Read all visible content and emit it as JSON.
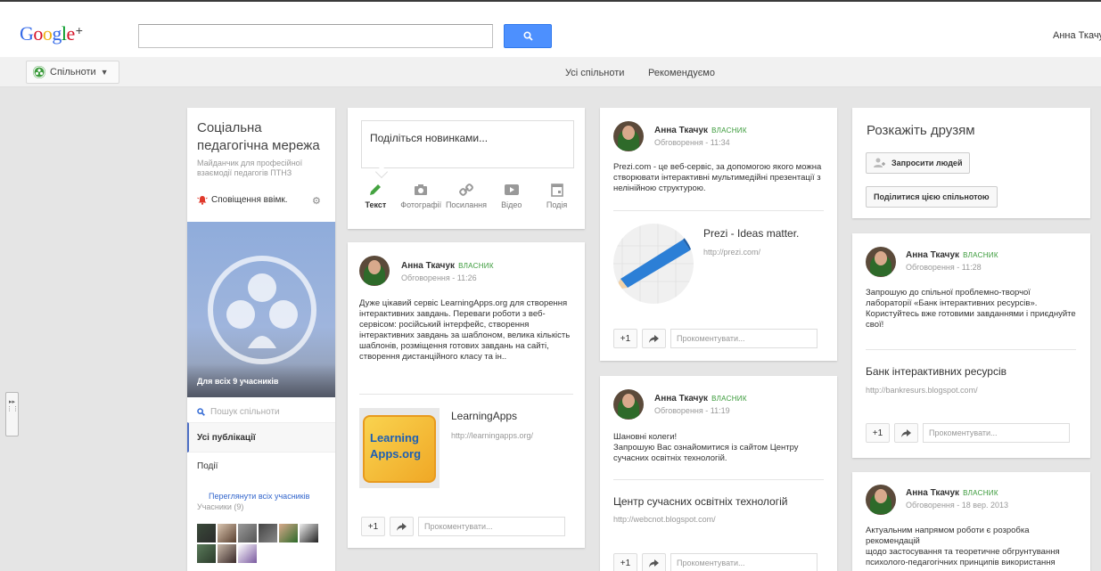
{
  "header": {
    "logo_text": "Google",
    "logo_plus": "+",
    "search_placeholder": "",
    "search_button_icon": "search-icon",
    "user_name": "Анна Ткачук"
  },
  "subnav": {
    "communities_label": "Спільноти",
    "tabs": [
      "Усі спільноти",
      "Рекомендуємо"
    ]
  },
  "community": {
    "title": "Соціальна педагогічна мережа",
    "description": "Майданчик для професійної взаємодії педагогів ПТНЗ",
    "notifications": "Сповіщення ввімк.",
    "members_line": "Для всіх   9 учасників",
    "search_placeholder": "Пошук спільноти",
    "nav_all": "Усі публікації",
    "nav_events": "Події",
    "view_members": "Переглянути всіх учасників",
    "members_count": "Учасники (9)"
  },
  "share_box": {
    "placeholder": "Поділіться новинками...",
    "tools": [
      {
        "label": "Текст",
        "icon": "pencil-icon"
      },
      {
        "label": "Фотографії",
        "icon": "camera-icon"
      },
      {
        "label": "Посилання",
        "icon": "link-icon"
      },
      {
        "label": "Відео",
        "icon": "video-icon"
      },
      {
        "label": "Подія",
        "icon": "calendar-icon"
      }
    ]
  },
  "common": {
    "owner_badge": "ВЛАСНИК",
    "plus_one": "+1",
    "comment_placeholder": "Прокоментувати..."
  },
  "posts": {
    "learningapps": {
      "author": "Анна Ткачук",
      "meta": "Обговорення  -  11:26",
      "text": "Дуже цікавий сервіс LearningApps.org  для створення інтерактивних завдань.  Переваги роботи з веб-сервісом: російський інтерфейс, створення інтерактивних завдань за шаблоном, велика кількість шаблонів, розміщення готових завдань на сайті, створення дистанційного класу та ін..",
      "link_title": "LearningApps",
      "link_url": "http://learningapps.org/",
      "thumb_line1": "Learning",
      "thumb_line2": "Apps.org"
    },
    "prezi": {
      "author": "Анна Ткачук",
      "meta": "Обговорення  -  11:34",
      "text": "Prezi.com - це веб-сервіс, за допомогою якого можна створювати інтерактивні мультимедійні презентації з нелінійною структурою.",
      "link_title": "Prezi - Ideas matter.",
      "link_url": "http://prezi.com/"
    },
    "webcnot": {
      "author": "Анна Ткачук",
      "meta": "Обговорення  -  11:19",
      "text": "Шановні колеги!\nЗапрошую Вас ознайомитися із сайтом Центру сучасних освітніх технологій.",
      "link_title": "Центр сучасних освітніх технологій",
      "link_url": "http://webcnot.blogspot.com/"
    },
    "bankresurs": {
      "author": "Анна Ткачук",
      "meta": "Обговорення  -  11:28",
      "text": "Запрошую до спільної проблемно-творчої лабораторії «Банк інтерактивних ресурсів». Користуйтесь вже готовими завданнями і приєднуйте свої!",
      "link_title": "Банк інтерактивних ресурсів",
      "link_url": "http://bankresurs.blogspot.com/"
    },
    "sep": {
      "author": "Анна Ткачук",
      "meta": "Обговорення  -  18 вер. 2013",
      "text": "Актуальним напрямом роботи є розробка рекомендацій\nщодо застосування та теоретичне обгрунтування психолого-педагогічних принципів використання"
    }
  },
  "tell_friends": {
    "title": "Розкажіть друзям",
    "invite_label": "Запросити людей",
    "share_label": "Поділитися цією спільнотою"
  },
  "colors": {
    "accent_blue": "#4d90fe",
    "owner_green": "#3a9a3a",
    "link_blue": "#3366cc"
  }
}
